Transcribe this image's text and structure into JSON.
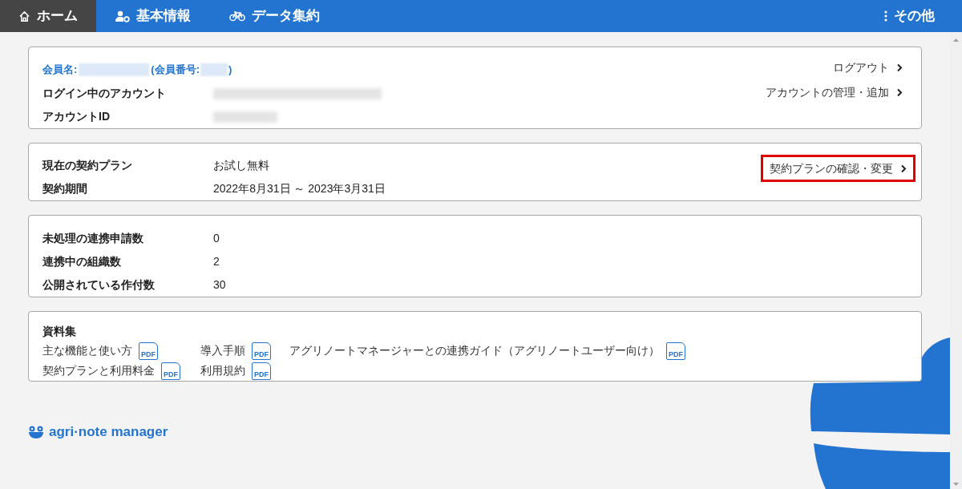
{
  "nav": {
    "tabs": [
      {
        "label": "ホーム",
        "selected": true
      },
      {
        "label": "基本情報",
        "selected": false
      },
      {
        "label": "データ集約",
        "selected": false
      }
    ],
    "more": {
      "label": "その他"
    }
  },
  "account_card": {
    "member_label": "会員名:",
    "member_number_label": "(会員番号:",
    "member_number_close": ")",
    "rows": [
      {
        "label": "ログイン中のアカウント"
      },
      {
        "label": "アカウントID"
      }
    ],
    "links": [
      {
        "label": "ログアウト"
      },
      {
        "label": "アカウントの管理・追加"
      }
    ]
  },
  "plan_card": {
    "rows": [
      {
        "label": "現在の契約プラン",
        "value": "お試し無料"
      },
      {
        "label": "契約期間",
        "value": "2022年8月31日 ～ 2023年3月31日"
      }
    ],
    "link": {
      "label": "契約プランの確認・変更",
      "highlighted": true
    }
  },
  "stats_card": {
    "rows": [
      {
        "label": "未処理の連携申請数",
        "value": "0"
      },
      {
        "label": "連携中の組織数",
        "value": "2"
      },
      {
        "label": "公開されている作付数",
        "value": "30"
      }
    ]
  },
  "documents": {
    "title": "資料集",
    "columns": [
      [
        {
          "label": "主な機能と使い方",
          "icon_text": "PDF"
        },
        {
          "label": "契約プランと利用料金",
          "icon_text": "PDF"
        }
      ],
      [
        {
          "label": "導入手順",
          "icon_text": "PDF"
        },
        {
          "label": "利用規約",
          "icon_text": "PDF"
        }
      ],
      [
        {
          "label": "アグリノートマネージャーとの連携ガイド（アグリノートユーザー向け）",
          "icon_text": "PDF"
        }
      ]
    ]
  },
  "footer": {
    "logo_text": "agri·note manager"
  }
}
